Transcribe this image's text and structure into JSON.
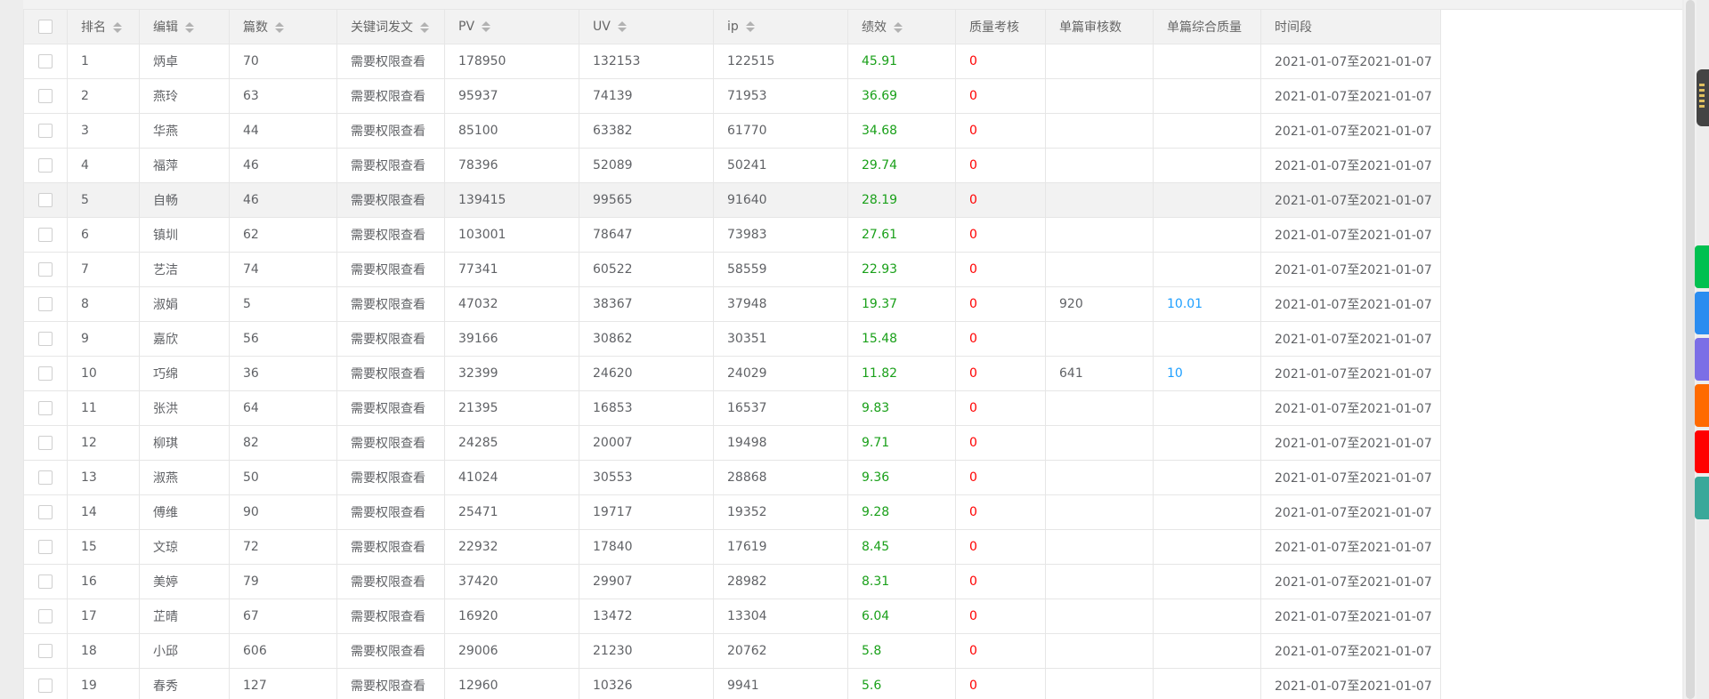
{
  "table": {
    "headers": [
      "排名",
      "编辑",
      "篇数",
      "关键词发文",
      "PV",
      "UV",
      "ip",
      "绩效",
      "质量考核",
      "单篇审核数",
      "单篇综合质量",
      "时间段"
    ],
    "sortable": [
      true,
      true,
      true,
      true,
      true,
      true,
      true,
      true,
      false,
      false,
      false,
      false
    ],
    "hover_row": 5,
    "rows": [
      [
        "1",
        "炳卓",
        "70",
        "需要权限查看",
        "178950",
        "132153",
        "122515",
        "45.91",
        "0",
        "",
        "",
        "2021-01-07至2021-01-07"
      ],
      [
        "2",
        "燕玲",
        "63",
        "需要权限查看",
        "95937",
        "74139",
        "71953",
        "36.69",
        "0",
        "",
        "",
        "2021-01-07至2021-01-07"
      ],
      [
        "3",
        "华燕",
        "44",
        "需要权限查看",
        "85100",
        "63382",
        "61770",
        "34.68",
        "0",
        "",
        "",
        "2021-01-07至2021-01-07"
      ],
      [
        "4",
        "福萍",
        "46",
        "需要权限查看",
        "78396",
        "52089",
        "50241",
        "29.74",
        "0",
        "",
        "",
        "2021-01-07至2021-01-07"
      ],
      [
        "5",
        "自畅",
        "46",
        "需要权限查看",
        "139415",
        "99565",
        "91640",
        "28.19",
        "0",
        "",
        "",
        "2021-01-07至2021-01-07"
      ],
      [
        "6",
        "镇圳",
        "62",
        "需要权限查看",
        "103001",
        "78647",
        "73983",
        "27.61",
        "0",
        "",
        "",
        "2021-01-07至2021-01-07"
      ],
      [
        "7",
        "艺洁",
        "74",
        "需要权限查看",
        "77341",
        "60522",
        "58559",
        "22.93",
        "0",
        "",
        "",
        "2021-01-07至2021-01-07"
      ],
      [
        "8",
        "淑娟",
        "5",
        "需要权限查看",
        "47032",
        "38367",
        "37948",
        "19.37",
        "0",
        "920",
        "10.01",
        "2021-01-07至2021-01-07"
      ],
      [
        "9",
        "嘉欣",
        "56",
        "需要权限查看",
        "39166",
        "30862",
        "30351",
        "15.48",
        "0",
        "",
        "",
        "2021-01-07至2021-01-07"
      ],
      [
        "10",
        "巧绵",
        "36",
        "需要权限查看",
        "32399",
        "24620",
        "24029",
        "11.82",
        "0",
        "641",
        "10",
        "2021-01-07至2021-01-07"
      ],
      [
        "11",
        "张洪",
        "64",
        "需要权限查看",
        "21395",
        "16853",
        "16537",
        "9.83",
        "0",
        "",
        "",
        "2021-01-07至2021-01-07"
      ],
      [
        "12",
        "柳琪",
        "82",
        "需要权限查看",
        "24285",
        "20007",
        "19498",
        "9.71",
        "0",
        "",
        "",
        "2021-01-07至2021-01-07"
      ],
      [
        "13",
        "淑燕",
        "50",
        "需要权限查看",
        "41024",
        "30553",
        "28868",
        "9.36",
        "0",
        "",
        "",
        "2021-01-07至2021-01-07"
      ],
      [
        "14",
        "傅维",
        "90",
        "需要权限查看",
        "25471",
        "19717",
        "19352",
        "9.28",
        "0",
        "",
        "",
        "2021-01-07至2021-01-07"
      ],
      [
        "15",
        "文琼",
        "72",
        "需要权限查看",
        "22932",
        "17840",
        "17619",
        "8.45",
        "0",
        "",
        "",
        "2021-01-07至2021-01-07"
      ],
      [
        "16",
        "美婷",
        "79",
        "需要权限查看",
        "37420",
        "29907",
        "28982",
        "8.31",
        "0",
        "",
        "",
        "2021-01-07至2021-01-07"
      ],
      [
        "17",
        "芷晴",
        "67",
        "需要权限查看",
        "16920",
        "13472",
        "13304",
        "6.04",
        "0",
        "",
        "",
        "2021-01-07至2021-01-07"
      ],
      [
        "18",
        "小邱",
        "606",
        "需要权限查看",
        "29006",
        "21230",
        "20762",
        "5.8",
        "0",
        "",
        "",
        "2021-01-07至2021-01-07"
      ],
      [
        "19",
        "春秀",
        "127",
        "需要权限查看",
        "12960",
        "10326",
        "9941",
        "5.6",
        "0",
        "",
        "",
        "2021-01-07至2021-01-07"
      ]
    ]
  },
  "colors": {
    "perf": "#1aa01a",
    "quality_check": "#ff0000",
    "composite_quality": "#1e9fff",
    "side_tabs": [
      "#00c050",
      "#2a8cf0",
      "#7b6ee6",
      "#ff6a00",
      "#ff0000",
      "#3aa89a"
    ]
  },
  "icons": {
    "sort": "sort-caret-icon",
    "checkbox": "checkbox-icon"
  }
}
